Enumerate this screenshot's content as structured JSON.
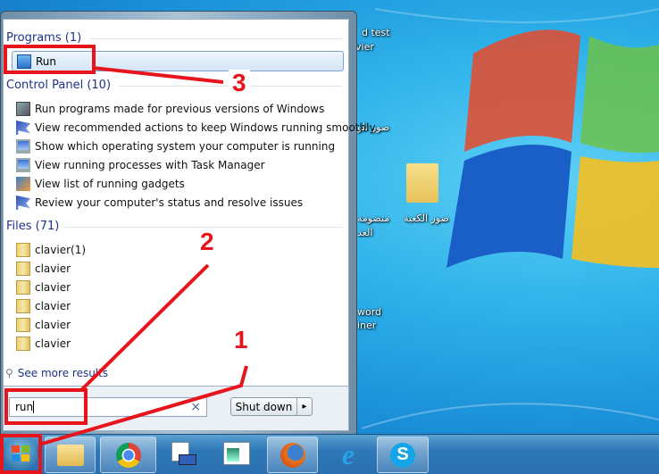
{
  "desktop": {
    "icons": [
      {
        "label": "d test"
      },
      {
        "label": "vier"
      },
      {
        "label": "صور تلو"
      },
      {
        "label": "منضومة"
      },
      {
        "label": "العد"
      },
      {
        "label": "صور الكعبة"
      },
      {
        "label": "word"
      },
      {
        "label": "iner"
      }
    ]
  },
  "start_menu": {
    "programs": {
      "header": "Programs (1)",
      "items": [
        {
          "label": "Run",
          "icon": "run-icon"
        }
      ]
    },
    "control_panel": {
      "header": "Control Panel (10)",
      "items": [
        {
          "label": "Run programs made for previous versions of Windows",
          "icon": "compat-icon"
        },
        {
          "label": "View recommended actions to keep Windows running smoothly",
          "icon": "flag-icon"
        },
        {
          "label": "Show which operating system your computer is running",
          "icon": "monitor-icon"
        },
        {
          "label": "View running processes with Task Manager",
          "icon": "monitor-icon"
        },
        {
          "label": "View list of running gadgets",
          "icon": "gadget-icon"
        },
        {
          "label": "Review your computer's status and resolve issues",
          "icon": "flag-icon"
        }
      ]
    },
    "files": {
      "header": "Files (71)",
      "items": [
        {
          "label": "clavier(1)"
        },
        {
          "label": "clavier"
        },
        {
          "label": "clavier"
        },
        {
          "label": "clavier"
        },
        {
          "label": "clavier"
        },
        {
          "label": "clavier"
        }
      ]
    },
    "see_more": "See more results",
    "search": {
      "value": "run",
      "clear": "×"
    },
    "shutdown": {
      "label": "Shut down",
      "arrow": "▸"
    }
  },
  "taskbar": {
    "items": [
      "start-orb",
      "windows-explorer",
      "google-chrome",
      "task-manager",
      "window-app",
      "firefox",
      "internet-explorer",
      "skype"
    ]
  },
  "annotations": {
    "step1": "1",
    "step2": "2",
    "step3": "3",
    "color": "#e8141c"
  }
}
